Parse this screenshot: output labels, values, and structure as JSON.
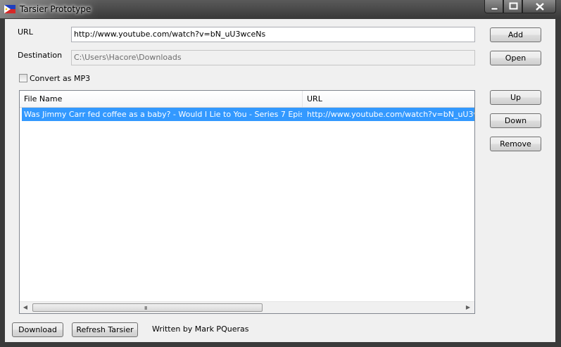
{
  "window": {
    "title": "Tarsier Prototype",
    "controls": [
      "minimize",
      "maximize",
      "close"
    ]
  },
  "form": {
    "url_label": "URL",
    "url_value": "http://www.youtube.com/watch?v=bN_uU3wceNs",
    "destination_label": "Destination",
    "destination_value": "C:\\Users\\Hacore\\Downloads",
    "convert_label": "Convert as MP3",
    "convert_checked": false
  },
  "buttons": {
    "add": "Add",
    "open": "Open",
    "up": "Up",
    "down": "Down",
    "remove": "Remove",
    "download": "Download",
    "refresh": "Refresh Tarsier"
  },
  "list": {
    "columns": [
      "File Name",
      "URL"
    ],
    "rows": [
      {
        "file_name": "Was Jimmy Carr fed coffee as a baby? - Would I Lie to You - Series 7 Epis...",
        "url": "http://www.youtube.com/watch?v=bN_uU3v",
        "selected": true
      }
    ],
    "scroll_grip": "III"
  },
  "footer": {
    "credit": "Written by Mark PQueras"
  },
  "colors": {
    "selection": "#3399ff",
    "client_bg": "#f0f0f0"
  }
}
